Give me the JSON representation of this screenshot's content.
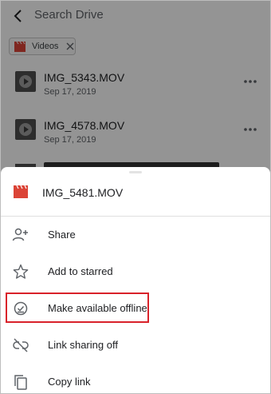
{
  "search": {
    "placeholder": "Search Drive"
  },
  "filter_chip": {
    "label": "Videos",
    "icon": "clapperboard-icon"
  },
  "files": [
    {
      "name": "IMG_5343.MOV",
      "date": "Sep 17, 2019"
    },
    {
      "name": "IMG_4578.MOV",
      "date": "Sep 17, 2019"
    }
  ],
  "sheet": {
    "file_name": "IMG_5481.MOV",
    "file_icon": "clapperboard-icon",
    "items": [
      {
        "label": "Share",
        "icon": "add-person-icon"
      },
      {
        "label": "Add to starred",
        "icon": "star-icon"
      },
      {
        "label": "Make available offline",
        "icon": "offline-check-icon",
        "highlighted": true
      },
      {
        "label": "Link sharing off",
        "icon": "link-off-icon"
      },
      {
        "label": "Copy link",
        "icon": "copy-icon"
      }
    ]
  },
  "colors": {
    "video_red": "#db4437",
    "highlight_red": "#d9222a",
    "icon_gray": "#5f6368",
    "text": "#202124"
  }
}
